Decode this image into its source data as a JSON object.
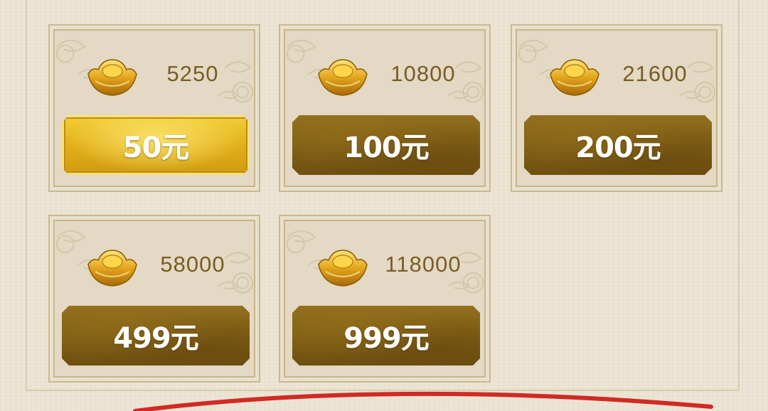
{
  "colors": {
    "background": "#ede5d5",
    "card_background": "#e3d9c4",
    "card_border": "#cbb88e",
    "amount_text": "#7a5c24",
    "price_button": "#7d5d14",
    "price_button_selected": "#e2b01c",
    "price_text": "#ffffff",
    "accent_red": "#d12a24"
  },
  "currency_icon": "gold-ingot-icon",
  "packages": [
    {
      "amount": "5250",
      "price": "50元",
      "selected": true
    },
    {
      "amount": "10800",
      "price": "100元",
      "selected": false
    },
    {
      "amount": "21600",
      "price": "200元",
      "selected": false
    },
    {
      "amount": "58000",
      "price": "499元",
      "selected": false
    },
    {
      "amount": "118000",
      "price": "999元",
      "selected": false
    }
  ]
}
